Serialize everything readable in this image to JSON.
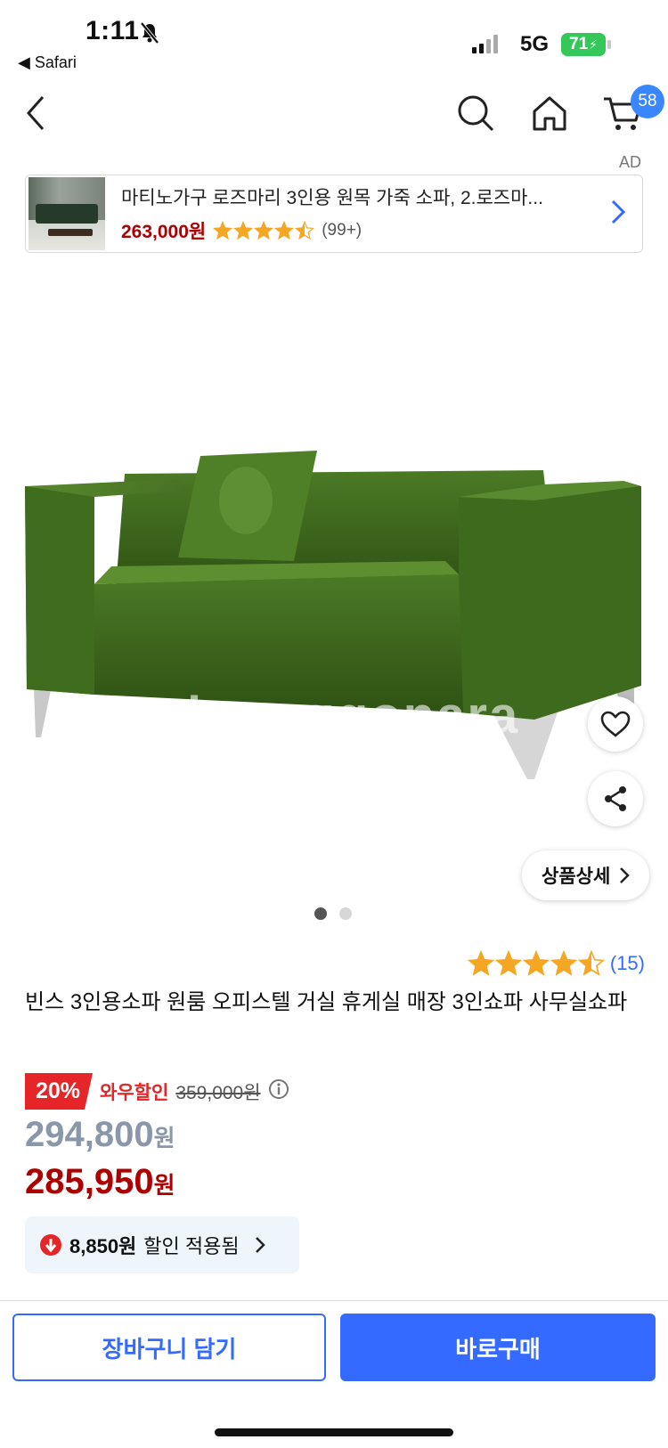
{
  "status_bar": {
    "time": "1:11",
    "back_app": "◀ Safari",
    "network": "5G",
    "battery": "71"
  },
  "nav": {
    "cart_count": "58"
  },
  "ad": {
    "label": "AD",
    "title": "마티노가구 로즈마리 3인용 원목 가죽 소파, 2.로즈마...",
    "price": "263,000원",
    "rating": 4.5,
    "review_count": "(99+)"
  },
  "gallery": {
    "watermark": "joonggonara",
    "current_index": 1,
    "total": 2,
    "detail_button": "상품상세"
  },
  "product": {
    "rating": 4.5,
    "review_count": "(15)",
    "title": "빈스 3인용소파 원룸 오피스텔 거실 휴게실 매장 3인쇼파 사무실쇼파",
    "discount_badge": "20%",
    "wow_label": "와우할인",
    "original_price": "359,000원",
    "price": "294,800",
    "price_unit": "원",
    "wow_price": "285,950",
    "wow_price_unit": "원",
    "coupon_amount": "8,850원",
    "coupon_text": "할인 적용됨"
  },
  "actions": {
    "add_to_cart": "장바구니 담기",
    "buy_now": "바로구매"
  },
  "colors": {
    "accent_blue": "#346aff",
    "price_red": "#ae0000",
    "discount_red": "#e52528",
    "star_orange": "#f5a623",
    "sofa_green": "#3f6b1f"
  }
}
